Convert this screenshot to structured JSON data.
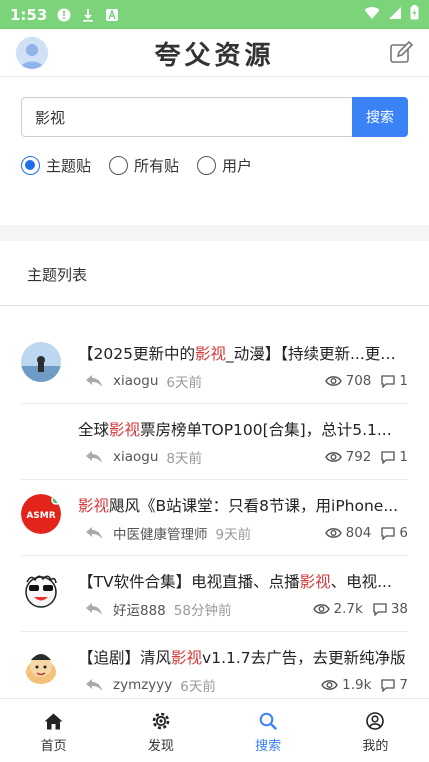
{
  "status_bar": {
    "time": "1:53"
  },
  "header": {
    "title": "夸父资源"
  },
  "search": {
    "value": "影视",
    "button_label": "搜索"
  },
  "filter": {
    "options": [
      {
        "label": "主题贴",
        "checked": true
      },
      {
        "label": "所有贴",
        "checked": false
      },
      {
        "label": "用户",
        "checked": false
      }
    ]
  },
  "section": {
    "title": "主题列表"
  },
  "topics": [
    {
      "title_pre": "【2025更新中的",
      "keyword": "影视",
      "title_post": "_动漫】【持续更新...更新中",
      "user": "xiaogu",
      "time": "6天前",
      "views": "708",
      "comments": "1"
    },
    {
      "title_pre": "全球",
      "keyword": "影视",
      "title_post": "票房榜单TOP100[合集]，总计5.1...",
      "user": "xiaogu",
      "time": "8天前",
      "views": "792",
      "comments": "1"
    },
    {
      "title_pre": "",
      "keyword": "影视",
      "title_post": "飓风《B站课堂：只看8节课，用iPhone...",
      "user": "中医健康管理师",
      "time": "9天前",
      "views": "804",
      "comments": "6",
      "avatar_text": "ASMR"
    },
    {
      "title_pre": "【TV软件合集】电视直播、点播",
      "keyword": "影视",
      "title_post": "、电视...",
      "user": "好运888",
      "time": "58分钟前",
      "views": "2.7k",
      "comments": "38"
    },
    {
      "title_pre": "【追剧】清风",
      "keyword": "影视",
      "title_post": "v1.1.7去广告，去更新纯净版",
      "user": "zymzyyy",
      "time": "6天前",
      "views": "1.9k",
      "comments": "7"
    }
  ],
  "bottom_nav": [
    {
      "label": "首页",
      "icon": "home-icon",
      "active": false
    },
    {
      "label": "发现",
      "icon": "discover-icon",
      "active": false
    },
    {
      "label": "搜索",
      "icon": "search-icon",
      "active": true
    },
    {
      "label": "我的",
      "icon": "profile-icon",
      "active": false
    }
  ],
  "colors": {
    "accent": "#3b82f6",
    "status_bar": "#7bd47a",
    "keyword": "#d63a3a"
  }
}
